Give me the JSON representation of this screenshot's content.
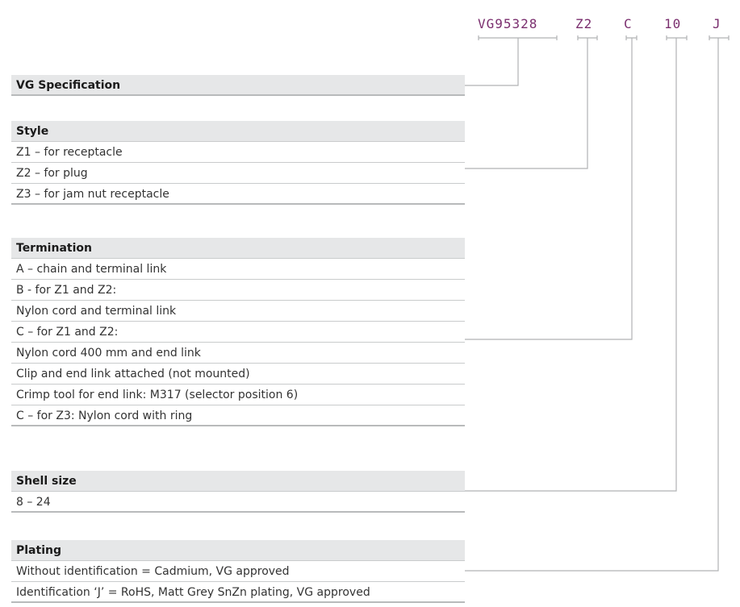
{
  "part_number": {
    "segments": [
      "VG95328",
      "Z2",
      "C",
      "10",
      "J"
    ]
  },
  "sections": {
    "spec": {
      "header": "VG Specification",
      "items": []
    },
    "style": {
      "header": "Style",
      "items": [
        "Z1 – for receptacle",
        "Z2 – for plug",
        "Z3 – for jam nut receptacle"
      ]
    },
    "termination": {
      "header": "Termination",
      "items": [
        "A – chain and terminal link",
        "B - for Z1 and Z2:",
        "Nylon cord and terminal link",
        "C – for Z1 and Z2:",
        "Nylon cord 400 mm and end link",
        "Clip and end link attached (not mounted)",
        "Crimp tool for end link: M317 (selector position 6)",
        "C – for Z3: Nylon cord with ring"
      ]
    },
    "shell_size": {
      "header": "Shell size",
      "items": [
        "8 – 24"
      ]
    },
    "plating": {
      "header": "Plating",
      "items": [
        "Without identification = Cadmium, VG approved",
        "Identification ‘J’ = RoHS, Matt Grey SnZn plating, VG approved"
      ]
    }
  },
  "colors": {
    "accent": "#7a2e6e",
    "header_bg": "#e6e7e8",
    "rule": "#c9cbcc",
    "connector": "#b0b2b4"
  }
}
